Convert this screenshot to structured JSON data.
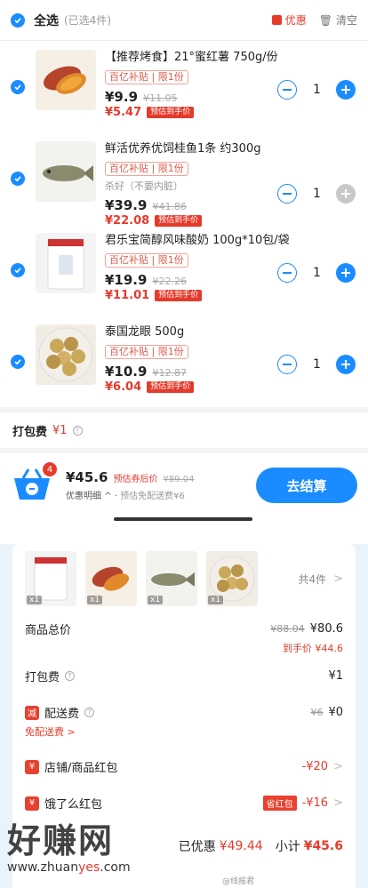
{
  "header": {
    "select_all": "全选",
    "selected": "(已选4件)",
    "promo": "优惠",
    "clear": "清空"
  },
  "items": [
    {
      "title": "【推荐烤食】21°蜜红薯 750g/份",
      "tag": "百亿补贴 | 限1份",
      "sub": "",
      "price": "¥9.9",
      "orig": "¥11.05",
      "final": "¥5.47",
      "badge": "预估到手价",
      "qty": "1"
    },
    {
      "title": "鲜活优养优饲桂鱼1条 约300g",
      "tag": "百亿补贴 | 限1份",
      "sub": "杀好（不要内脏）",
      "price": "¥39.9",
      "orig": "¥41.86",
      "final": "¥22.08",
      "badge": "预估到手价",
      "qty": "1"
    },
    {
      "title": "君乐宝简醇风味酸奶 100g*10包/袋",
      "tag": "百亿补贴 | 限1份",
      "sub": "",
      "price": "¥19.9",
      "orig": "¥22.26",
      "final": "¥11.01",
      "badge": "预估到手价",
      "qty": "1"
    },
    {
      "title": "泰国龙眼 500g",
      "tag": "百亿补贴 | 限1份",
      "sub": "",
      "price": "¥10.9",
      "orig": "¥12.87",
      "final": "¥6.04",
      "badge": "预估到手价",
      "qty": "1"
    }
  ],
  "pack": {
    "label": "打包费",
    "value": "¥1"
  },
  "bottom": {
    "count": "4",
    "total": "¥45.6",
    "after": "预估券后价",
    "orig": "¥89.04",
    "detail": "优惠明细 ^",
    "free": "预估免配送费¥6",
    "pay": "去结算"
  },
  "sheet": {
    "count": "共4件",
    "q": "x1",
    "goods_label": "商品总价",
    "goods_orig": "¥88.04",
    "goods_price": "¥80.6",
    "goods_final": "到手价 ¥44.6",
    "pack_label": "打包费",
    "pack_price": "¥1",
    "ship_label": "配送费",
    "ship_orig": "¥6",
    "ship_price": "¥0",
    "ship_free": "免配送费 >",
    "ship_icon": "减",
    "shop_label": "店铺/商品红包",
    "shop_val": "-¥20",
    "ele_label": "饿了么红包",
    "ele_badge": "省红包",
    "ele_val": "-¥16",
    "rmb_icon": "¥",
    "saved_label": "已优惠",
    "saved": "¥49.44",
    "sub_label": "小计",
    "subtotal": "¥45.6"
  },
  "watermark": {
    "big": "好赚网",
    "url_a": "www.zhuan",
    "url_b": "yes",
    "url_c": ".com",
    "weibo": "@线报君"
  }
}
